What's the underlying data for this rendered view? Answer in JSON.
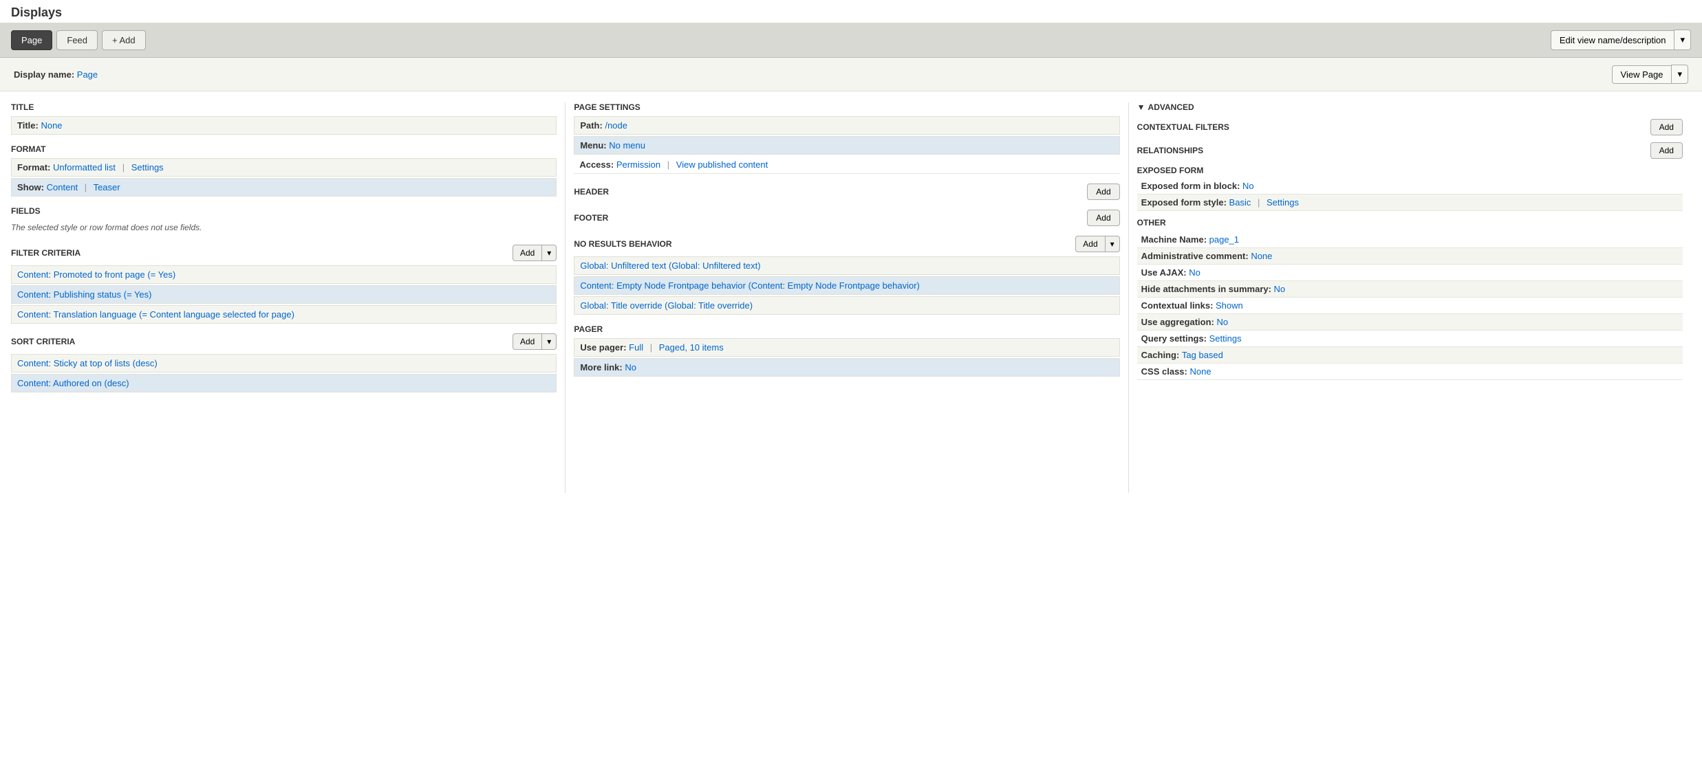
{
  "page_title": "Displays",
  "top_tabs": [
    {
      "label": "Page",
      "active": true
    },
    {
      "label": "Feed",
      "active": false
    },
    {
      "label": "+ Add",
      "active": false,
      "is_add": true
    }
  ],
  "edit_view_btn": "Edit view name/description",
  "display_name_label": "Display name:",
  "display_name_value": "Page",
  "view_page_btn": "View Page",
  "left_column": {
    "title_section": {
      "header": "TITLE",
      "title_label": "Title:",
      "title_value": "None"
    },
    "format_section": {
      "header": "FORMAT",
      "format_label": "Format:",
      "format_value": "Unformatted list",
      "format_settings": "Settings",
      "show_label": "Show:",
      "show_value": "Content",
      "show_value2": "Teaser"
    },
    "fields_section": {
      "header": "FIELDS",
      "note": "The selected style or row format does not use fields."
    },
    "filter_criteria_section": {
      "header": "FILTER CRITERIA",
      "add_label": "Add",
      "items": [
        "Content: Promoted to front page (= Yes)",
        "Content: Publishing status (= Yes)",
        "Content: Translation language (= Content language selected for page)"
      ]
    },
    "sort_criteria_section": {
      "header": "SORT CRITERIA",
      "add_label": "Add",
      "items": [
        "Content: Sticky at top of lists (desc)",
        "Content: Authored on (desc)"
      ]
    }
  },
  "middle_column": {
    "page_settings_section": {
      "header": "PAGE SETTINGS",
      "path_label": "Path:",
      "path_value": "/node",
      "menu_label": "Menu:",
      "menu_value": "No menu",
      "access_label": "Access:",
      "access_value": "Permission",
      "access_value2": "View published content"
    },
    "header_section": {
      "header": "HEADER",
      "add_label": "Add"
    },
    "footer_section": {
      "header": "FOOTER",
      "add_label": "Add"
    },
    "no_results_section": {
      "header": "NO RESULTS BEHAVIOR",
      "add_label": "Add",
      "items": [
        "Global: Unfiltered text (Global: Unfiltered text)",
        "Content: Empty Node Frontpage behavior (Content: Empty Node Frontpage behavior)",
        "Global: Title override (Global: Title override)"
      ]
    },
    "pager_section": {
      "header": "PAGER",
      "use_pager_label": "Use pager:",
      "use_pager_value": "Full",
      "use_pager_value2": "Paged, 10 items",
      "more_link_label": "More link:",
      "more_link_value": "No"
    }
  },
  "right_column": {
    "advanced_title": "ADVANCED",
    "contextual_filters": {
      "header": "CONTEXTUAL FILTERS",
      "add_label": "Add"
    },
    "relationships": {
      "header": "RELATIONSHIPS",
      "add_label": "Add"
    },
    "exposed_form": {
      "header": "EXPOSED FORM",
      "in_block_label": "Exposed form in block:",
      "in_block_value": "No",
      "style_label": "Exposed form style:",
      "style_value": "Basic",
      "style_settings": "Settings"
    },
    "other": {
      "header": "OTHER",
      "items": [
        {
          "label": "Machine Name:",
          "value": "page_1",
          "is_link": true
        },
        {
          "label": "Administrative comment:",
          "value": "None",
          "is_link": false
        },
        {
          "label": "Use AJAX:",
          "value": "No",
          "is_link": false
        },
        {
          "label": "Hide attachments in summary:",
          "value": "No",
          "is_link": false
        },
        {
          "label": "Contextual links:",
          "value": "Shown",
          "is_link": true
        },
        {
          "label": "Use aggregation:",
          "value": "No",
          "is_link": false
        },
        {
          "label": "Query settings:",
          "value": "Settings",
          "is_link": true
        },
        {
          "label": "Caching:",
          "value": "Tag based",
          "is_link": true
        },
        {
          "label": "CSS class:",
          "value": "None",
          "is_link": false
        }
      ]
    }
  }
}
